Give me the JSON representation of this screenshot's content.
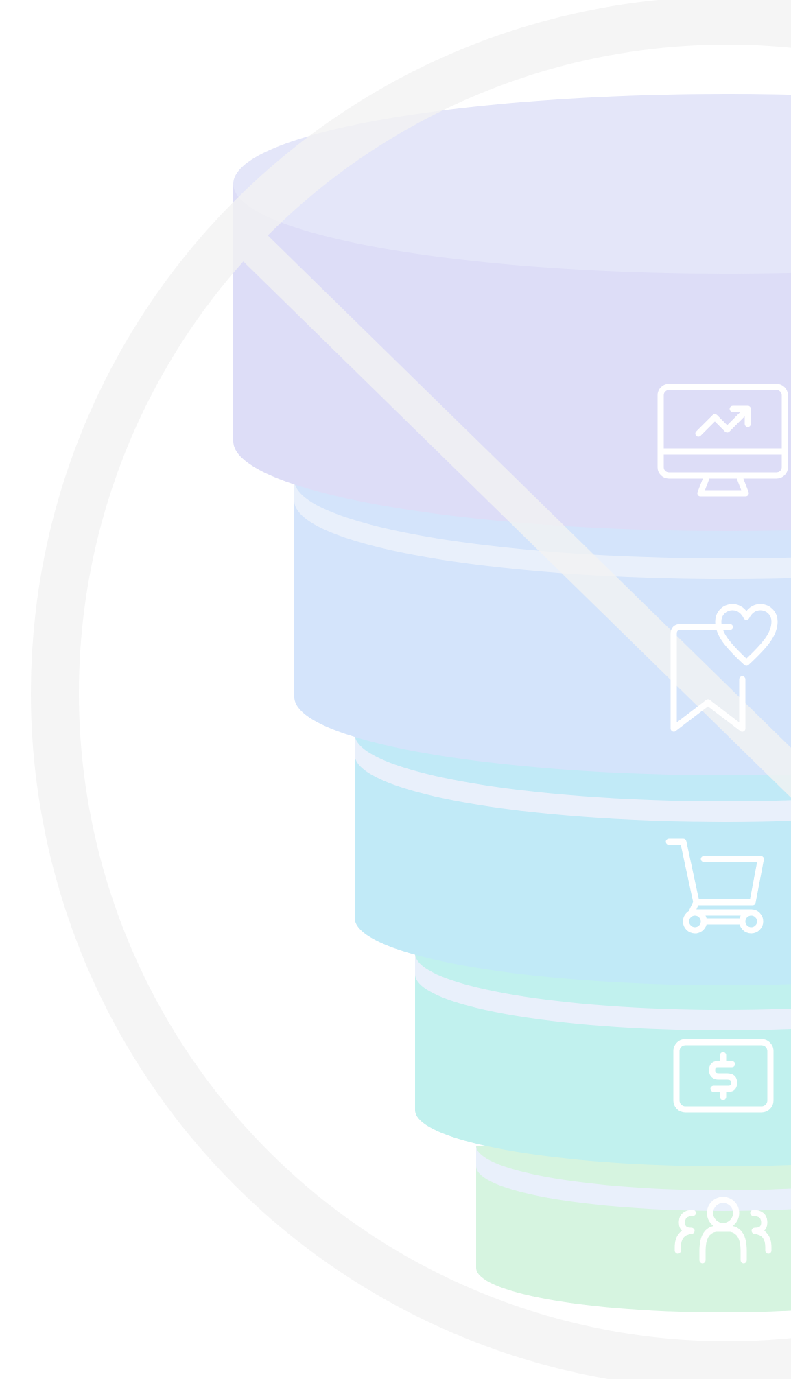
{
  "diagram": {
    "type": "stacked-funnel",
    "levels": [
      {
        "id": "analytics",
        "icon": "monitor-trend-icon",
        "color": "#ddddf7"
      },
      {
        "id": "engagement",
        "icon": "bookmark-heart-icon",
        "color": "#d4e4fb"
      },
      {
        "id": "purchase",
        "icon": "shopping-cart-icon",
        "color": "#c1eaf7"
      },
      {
        "id": "revenue",
        "icon": "money-bill-icon",
        "color": "#c1f1ee"
      },
      {
        "id": "customers",
        "icon": "user-group-icon",
        "color": "#d6f4e0"
      }
    ],
    "top_face_color": "#e4e6f9",
    "shadow_color": "#e9f0fb",
    "prohibition_sign": {
      "icon": "prohibition-sign-icon",
      "color": "#f3f3f3"
    }
  }
}
